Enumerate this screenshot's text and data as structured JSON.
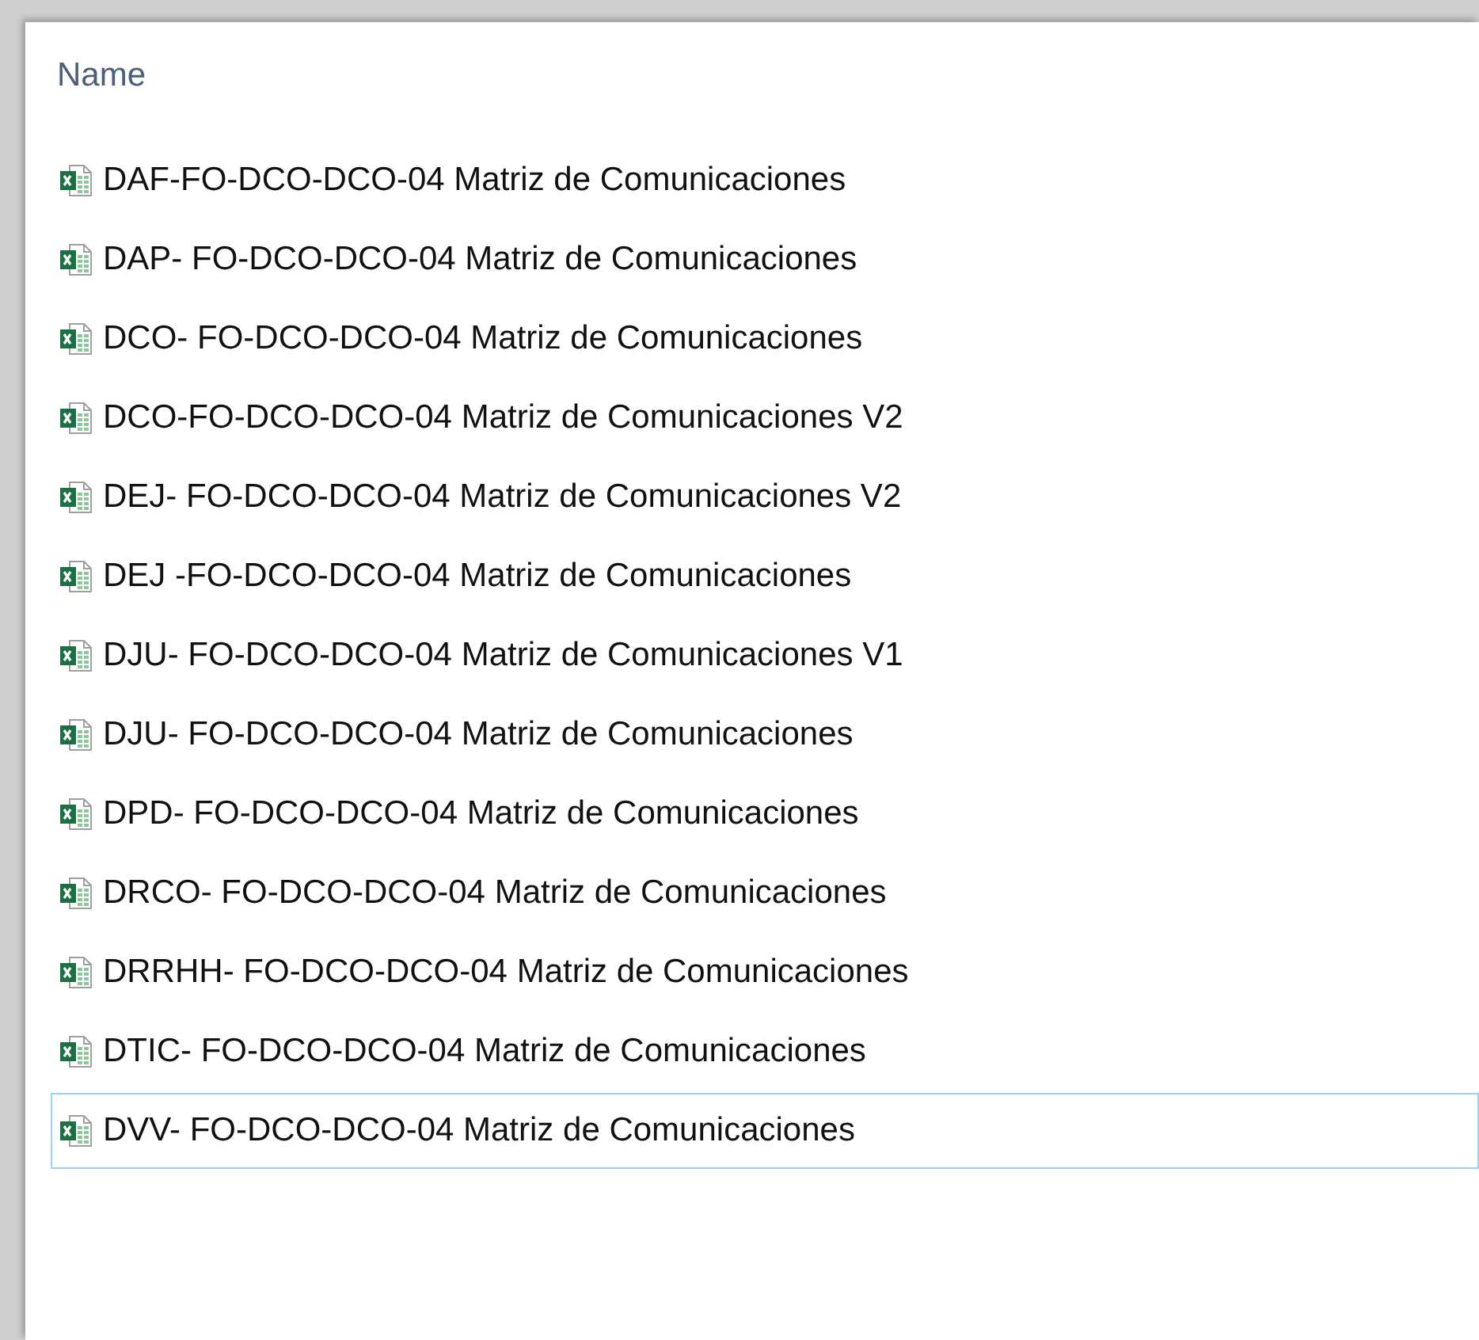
{
  "column_header": "Name",
  "files": [
    {
      "name": "DAF-FO-DCO-DCO-04 Matriz de Comunicaciones",
      "focused": false
    },
    {
      "name": "DAP- FO-DCO-DCO-04 Matriz de Comunicaciones",
      "focused": false
    },
    {
      "name": "DCO- FO-DCO-DCO-04 Matriz de Comunicaciones",
      "focused": false
    },
    {
      "name": "DCO-FO-DCO-DCO-04 Matriz de Comunicaciones V2",
      "focused": false
    },
    {
      "name": "DEJ- FO-DCO-DCO-04 Matriz de Comunicaciones V2",
      "focused": false
    },
    {
      "name": "DEJ -FO-DCO-DCO-04 Matriz de Comunicaciones",
      "focused": false
    },
    {
      "name": "DJU- FO-DCO-DCO-04 Matriz de Comunicaciones V1",
      "focused": false
    },
    {
      "name": "DJU- FO-DCO-DCO-04 Matriz de Comunicaciones",
      "focused": false
    },
    {
      "name": "DPD- FO-DCO-DCO-04 Matriz de Comunicaciones",
      "focused": false
    },
    {
      "name": "DRCO- FO-DCO-DCO-04 Matriz de Comunicaciones",
      "focused": false
    },
    {
      "name": "DRRHH- FO-DCO-DCO-04 Matriz de Comunicaciones",
      "focused": false
    },
    {
      "name": "DTIC- FO-DCO-DCO-04 Matriz de Comunicaciones",
      "focused": false
    },
    {
      "name": "DVV- FO-DCO-DCO-04 Matriz de Comunicaciones",
      "focused": true
    }
  ]
}
